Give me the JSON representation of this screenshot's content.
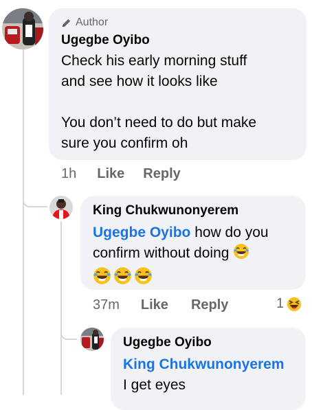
{
  "comments": [
    {
      "badge": "Author",
      "author": "Ugegbe Oyibo",
      "text_line1": "Check his early morning stuff",
      "text_line2": "and see how it looks like",
      "text_line3": "You don’t need to do but make",
      "text_line4": "sure you confirm oh",
      "time": "1h",
      "like": "Like",
      "reply": "Reply"
    },
    {
      "author": "King Chukwunonyerem",
      "mention": "Ugegbe Oyibo",
      "text_line1": " how do you",
      "text_line2": "confirm without doing",
      "time": "37m",
      "like": "Like",
      "reply": "Reply",
      "reaction_count": "1",
      "reaction_icon": "laughing-emoji",
      "trailing_emoji_icon": "tears-of-joy-emoji"
    },
    {
      "author": "Ugegbe Oyibo",
      "mention": "King Chukwunonyerem",
      "text_line1": "I get eyes"
    }
  ],
  "colors": {
    "bubble": "#f0f2f5",
    "meta": "#65676b",
    "mention": "#1b74e4",
    "thread_line": "#d4d6da"
  }
}
